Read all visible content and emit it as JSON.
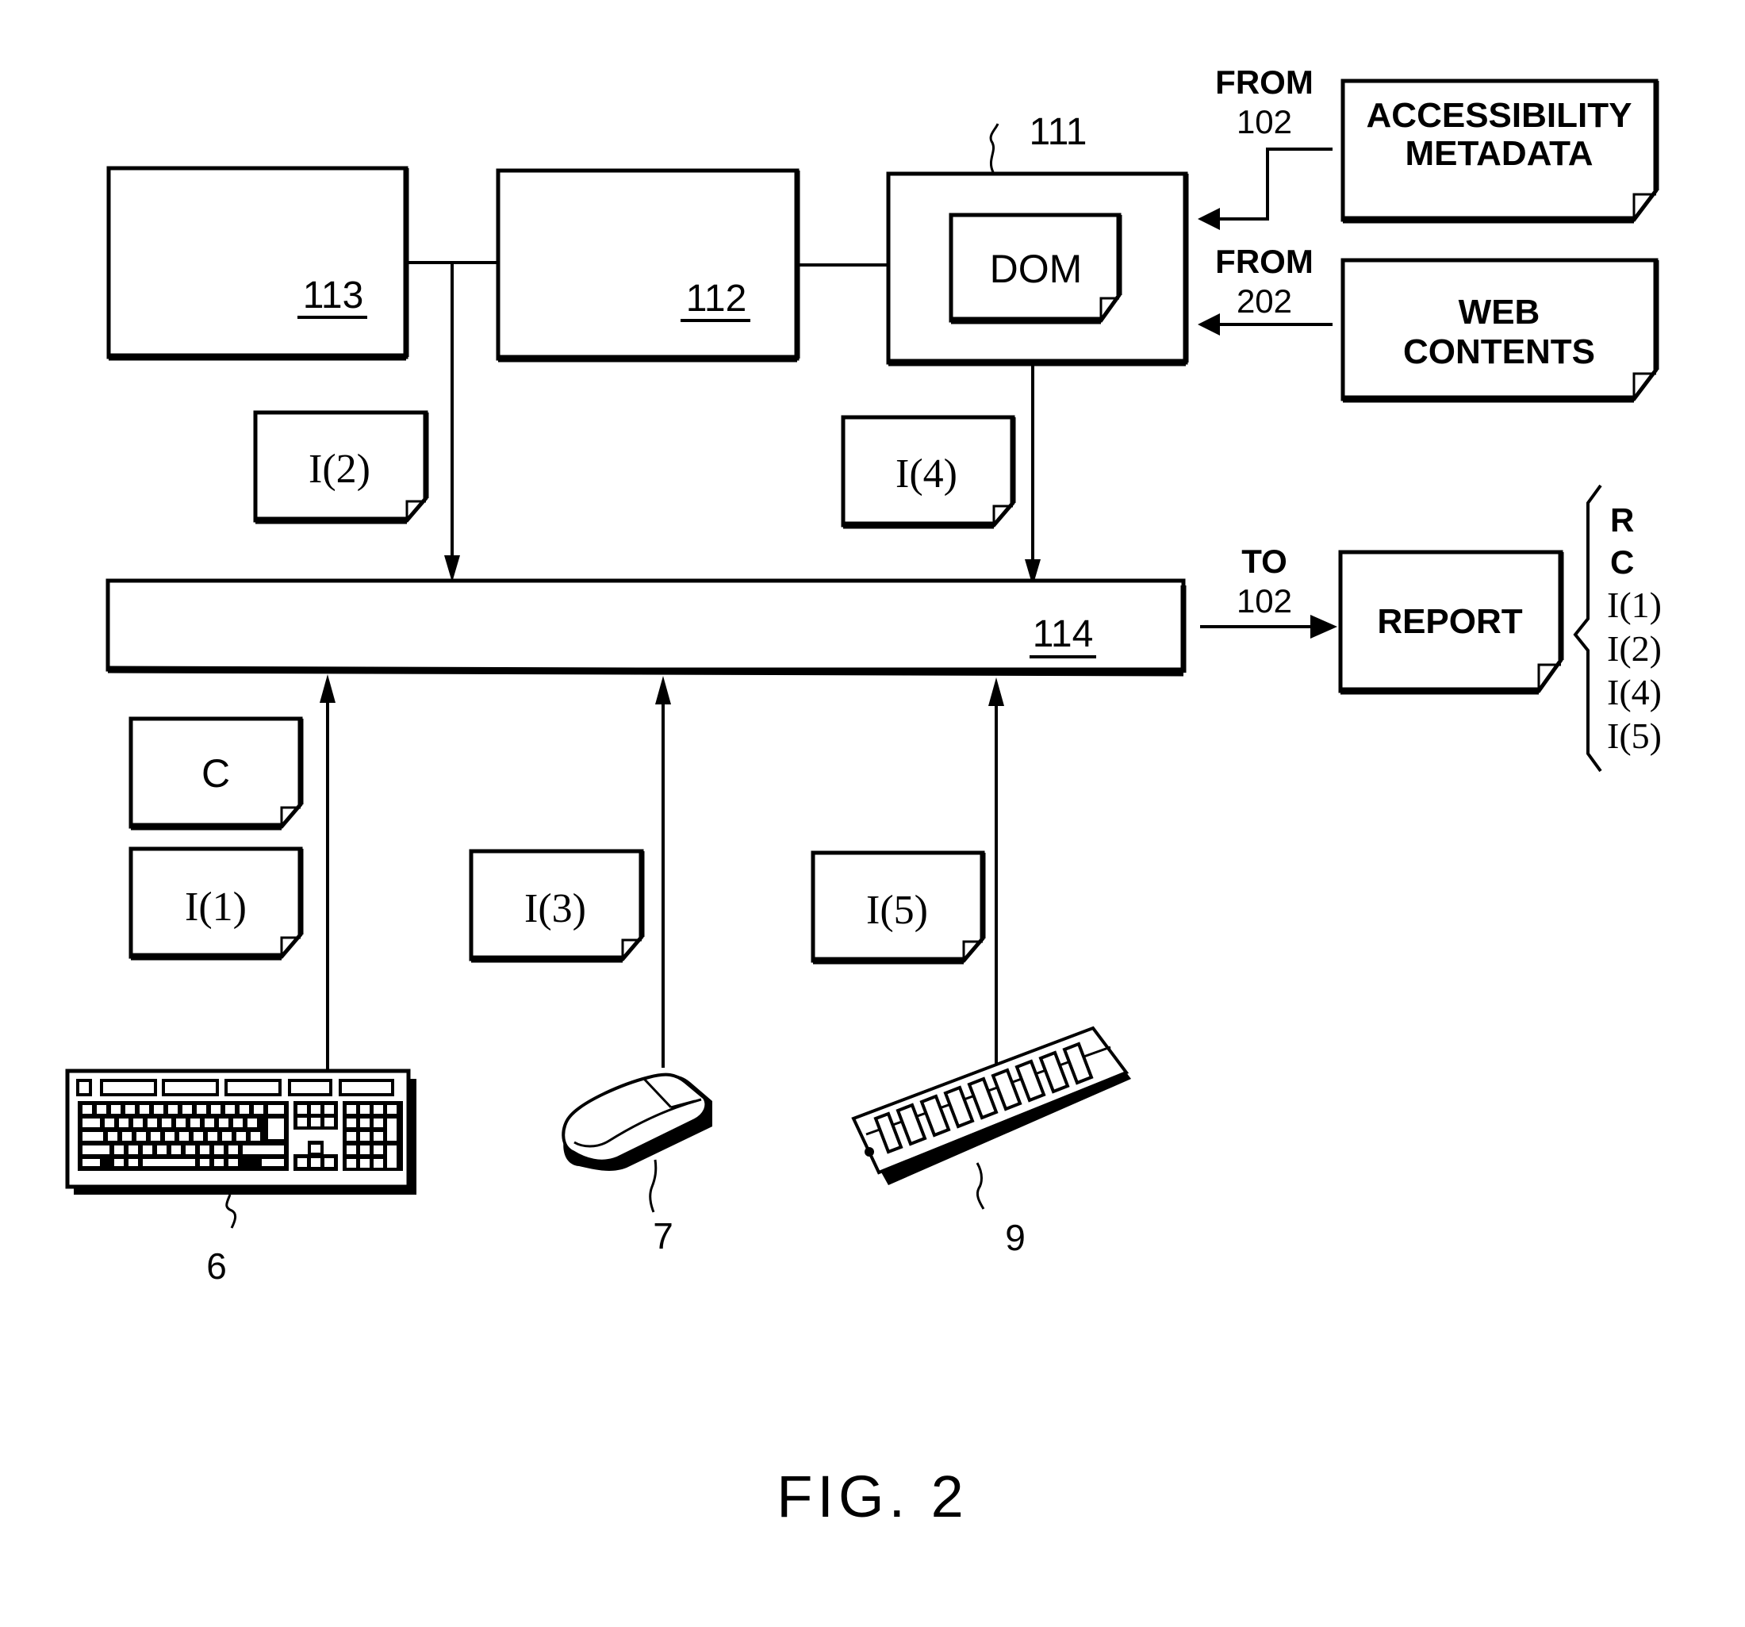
{
  "figure": {
    "caption": "FIG. 2",
    "colors": {
      "ink": "#000000",
      "paper": "#ffffff"
    }
  },
  "blocks": {
    "b113": {
      "ref": "113"
    },
    "b112": {
      "ref": "112"
    },
    "b111": {
      "ref": "111",
      "inner_doc": "DOM"
    },
    "b114": {
      "ref": "114"
    }
  },
  "sources": {
    "accessibility": {
      "line1": "ACCESSIBILITY",
      "line2": "METADATA",
      "from_line1": "FROM",
      "from_line2": "102"
    },
    "web": {
      "line1": "WEB",
      "line2": "CONTENTS",
      "from_line1": "FROM",
      "from_line2": "202"
    }
  },
  "output": {
    "to_line1": "TO",
    "to_line2": "102",
    "report_label": "REPORT",
    "report_contents": [
      "R",
      "C",
      "I(1)",
      "I(2)",
      "I(4)",
      "I(5)"
    ]
  },
  "info_docs": {
    "i2": "I(2)",
    "i4": "I(4)",
    "c": "C",
    "i1": "I(1)",
    "i3": "I(3)",
    "i5": "I(5)"
  },
  "devices": {
    "keyboard": {
      "ref": "6",
      "icon": "keyboard-icon"
    },
    "mouse": {
      "ref": "7",
      "icon": "mouse-icon"
    },
    "memory": {
      "ref": "9",
      "icon": "memory-module-icon"
    }
  }
}
